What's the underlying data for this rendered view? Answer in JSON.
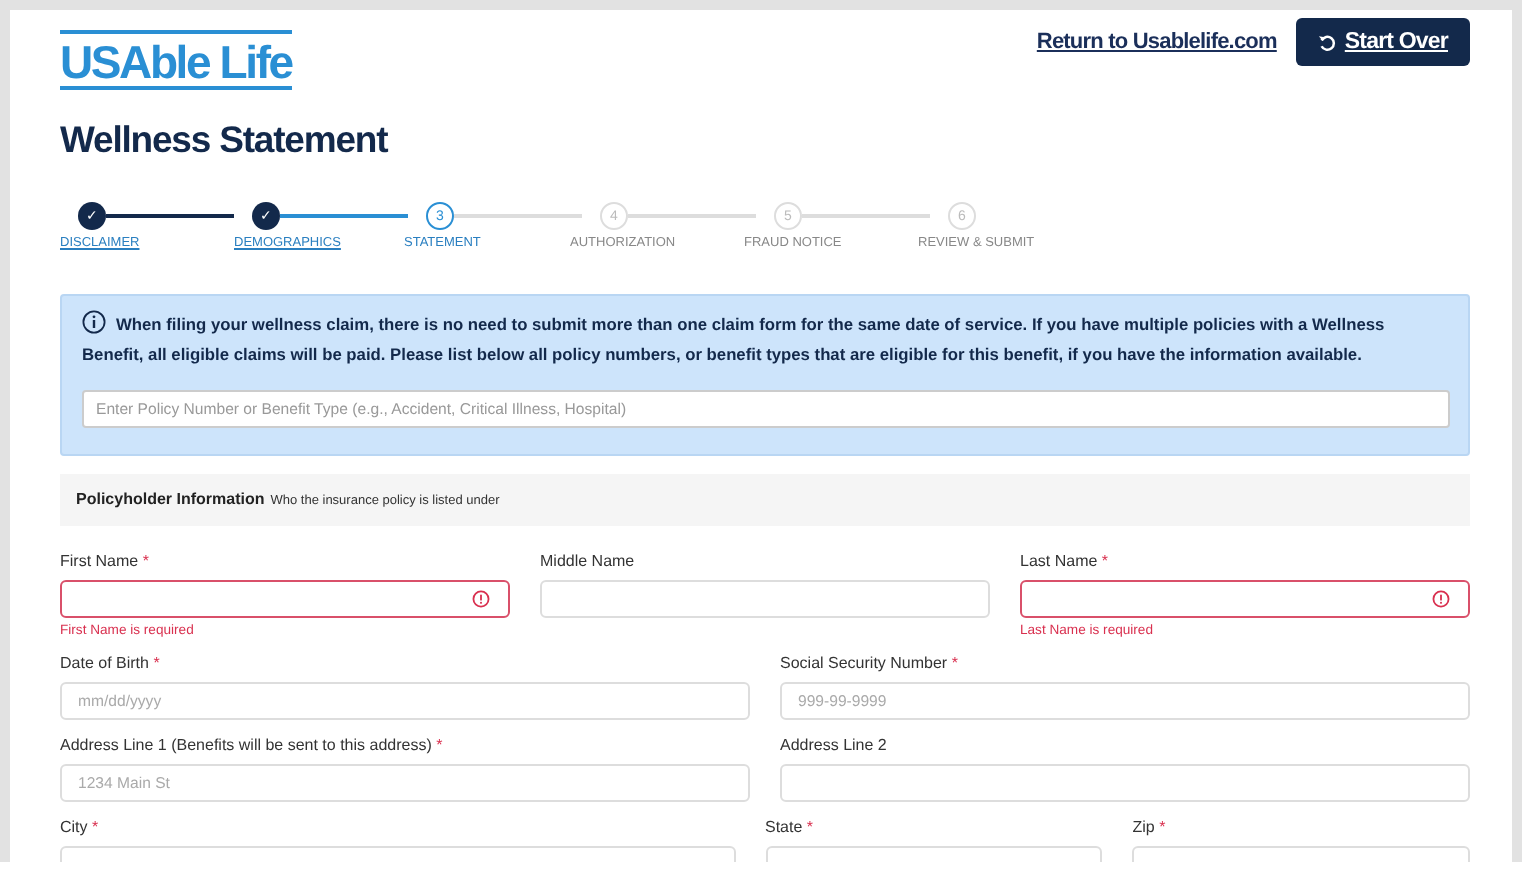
{
  "header": {
    "logo": "USAble Life",
    "return_link": "Return to Usablelife.com",
    "start_over": "Start Over"
  },
  "title": "Wellness Statement",
  "steps": [
    {
      "label": "DISCLAIMER",
      "marker": "✓",
      "completed": true,
      "selected": false
    },
    {
      "label": "DEMOGRAPHICS",
      "marker": "✓",
      "completed": true,
      "selected": false
    },
    {
      "label": "STATEMENT",
      "marker": "3",
      "completed": false,
      "selected": true
    },
    {
      "label": "AUTHORIZATION",
      "marker": "4",
      "completed": false,
      "selected": false
    },
    {
      "label": "FRAUD NOTICE",
      "marker": "5",
      "completed": false,
      "selected": false
    },
    {
      "label": "REVIEW & SUBMIT",
      "marker": "6",
      "completed": false,
      "selected": false
    }
  ],
  "notice": {
    "text": "When filing your wellness claim, there is no need to submit more than one claim form for the same date of service. If you have multiple policies with a Wellness Benefit, all eligible claims will be paid. Please list below all policy numbers, or benefit types that are eligible for this benefit, if you have the information available.",
    "placeholder": "Enter Policy Number or Benefit Type (e.g., Accident, Critical Illness, Hospital)"
  },
  "section": {
    "title": "Policyholder Information",
    "subtitle": "Who the insurance policy is listed under"
  },
  "rows": [
    {
      "kind": "thirds",
      "fields": [
        {
          "label": "First Name",
          "required_mark": "*",
          "invalid": true,
          "error": "First Name is required"
        },
        {
          "label": "Middle Name",
          "invalid": false
        },
        {
          "label": "Last Name",
          "required_mark": "*",
          "invalid": true,
          "error": "Last Name is required"
        }
      ]
    },
    {
      "kind": "halves",
      "fields": [
        {
          "label": "Date of Birth",
          "required_mark": "*",
          "invalid": false,
          "placeholder": "mm/dd/yyyy"
        },
        {
          "label": "Social Security Number",
          "required_mark": "*",
          "invalid": false,
          "placeholder": "999-99-9999"
        }
      ]
    },
    {
      "kind": "halves",
      "fields": [
        {
          "label": "Address Line 1 (Benefits will be sent to this address)",
          "required_mark": "*",
          "invalid": false,
          "placeholder": "1234 Main St"
        },
        {
          "label": "Address Line 2",
          "invalid": false
        }
      ]
    },
    {
      "kind": "half-quarters",
      "fields": [
        {
          "label": "City",
          "required_mark": "*",
          "invalid": false
        },
        {
          "label": "State",
          "required_mark": "*",
          "invalid": false
        },
        {
          "label": "Zip",
          "required_mark": "*",
          "invalid": false
        }
      ]
    }
  ]
}
